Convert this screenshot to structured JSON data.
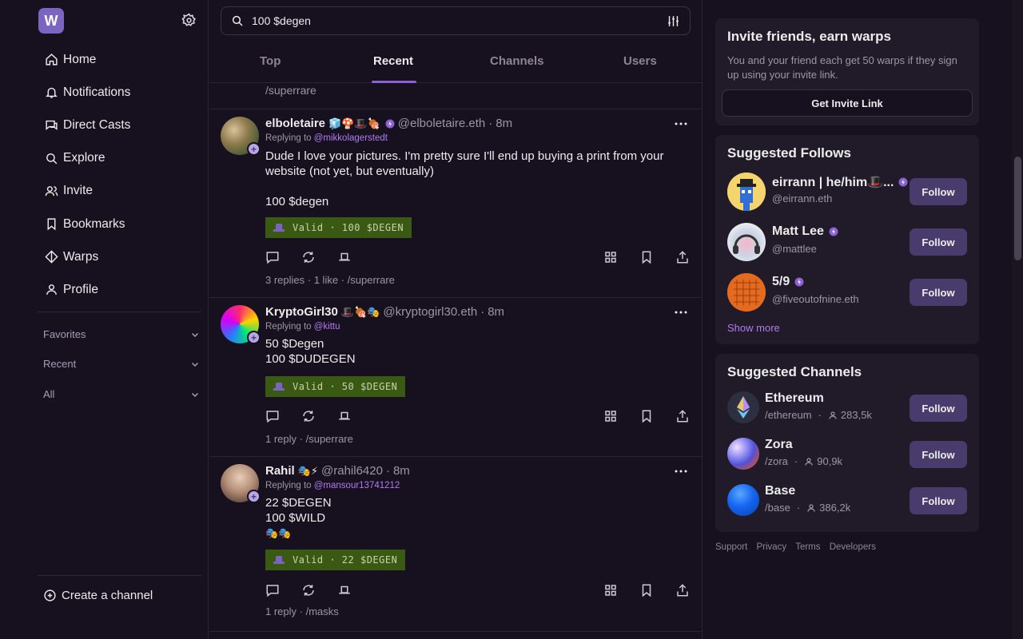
{
  "app": {
    "logo_letter": "W",
    "accent": "#7c65c1"
  },
  "nav": {
    "items": [
      {
        "label": "Home",
        "icon": "home-icon"
      },
      {
        "label": "Notifications",
        "icon": "bell-icon"
      },
      {
        "label": "Direct Casts",
        "icon": "chat-icon"
      },
      {
        "label": "Explore",
        "icon": "search-icon"
      },
      {
        "label": "Invite",
        "icon": "users-icon"
      },
      {
        "label": "Bookmarks",
        "icon": "bookmark-icon"
      },
      {
        "label": "Warps",
        "icon": "diamond-icon"
      },
      {
        "label": "Profile",
        "icon": "user-icon"
      }
    ],
    "sections": [
      "Favorites",
      "Recent",
      "All"
    ],
    "create_channel": "Create a channel"
  },
  "search": {
    "value": "100 $degen"
  },
  "tabs": {
    "items": [
      "Top",
      "Recent",
      "Channels",
      "Users"
    ],
    "active": "Recent"
  },
  "feed": {
    "previous_channel": "/superrare",
    "posts": [
      {
        "name": "elboletaire",
        "emojis": "🧊🍄🎩🍖",
        "handle": "@elboletaire.eth",
        "time": "8m",
        "reply_prefix": "Replying to",
        "reply_to": "@mikkolagerstedt",
        "lines": [
          "Dude I love your pictures. I'm pretty sure I'll end up buying a print from your",
          "website (not yet, but eventually)",
          "",
          "100 $degen"
        ],
        "tip": "Valid · 100 $DEGEN",
        "replies": "3 replies",
        "likes": "1 like",
        "channel": "/superrare"
      },
      {
        "name": "KryptoGirl30",
        "emojis": "🎩🍖🎭",
        "handle": "@kryptogirl30.eth",
        "time": "8m",
        "reply_prefix": "Replying to",
        "reply_to": "@kittu",
        "lines": [
          "50 $Degen",
          "100 $DUDEGEN"
        ],
        "tip": "Valid · 50 $DEGEN",
        "replies": "1 reply",
        "channel": "/superrare"
      },
      {
        "name": "Rahil",
        "emojis": "🎭⚡",
        "handle": "@rahil6420",
        "time": "8m",
        "reply_prefix": "Replying to",
        "reply_to": "@mansour13741212",
        "lines": [
          "22 $DEGEN",
          "100 $WILD",
          "🎭🎭"
        ],
        "tip": "Valid · 22 $DEGEN",
        "replies": "1 reply",
        "channel": "/masks"
      }
    ]
  },
  "invite": {
    "title": "Invite friends, earn warps",
    "desc": "You and your friend each get 50 warps if they sign up using your invite link.",
    "button": "Get Invite Link"
  },
  "suggested_follows": {
    "title": "Suggested Follows",
    "users": [
      {
        "name": "eirrann | he/him🎩...",
        "handle": "@eirrann.eth"
      },
      {
        "name": "Matt Lee",
        "handle": "@mattlee"
      },
      {
        "name": "5/9",
        "handle": "@fiveoutofnine.eth"
      }
    ],
    "follow_label": "Follow",
    "show_more": "Show more"
  },
  "suggested_channels": {
    "title": "Suggested Channels",
    "channels": [
      {
        "name": "Ethereum",
        "path": "/ethereum",
        "members": "283,5k"
      },
      {
        "name": "Zora",
        "path": "/zora",
        "members": "90,9k"
      },
      {
        "name": "Base",
        "path": "/base",
        "members": "386,2k"
      }
    ],
    "follow_label": "Follow"
  },
  "footer": {
    "links": [
      "Support",
      "Privacy",
      "Terms",
      "Developers"
    ]
  }
}
